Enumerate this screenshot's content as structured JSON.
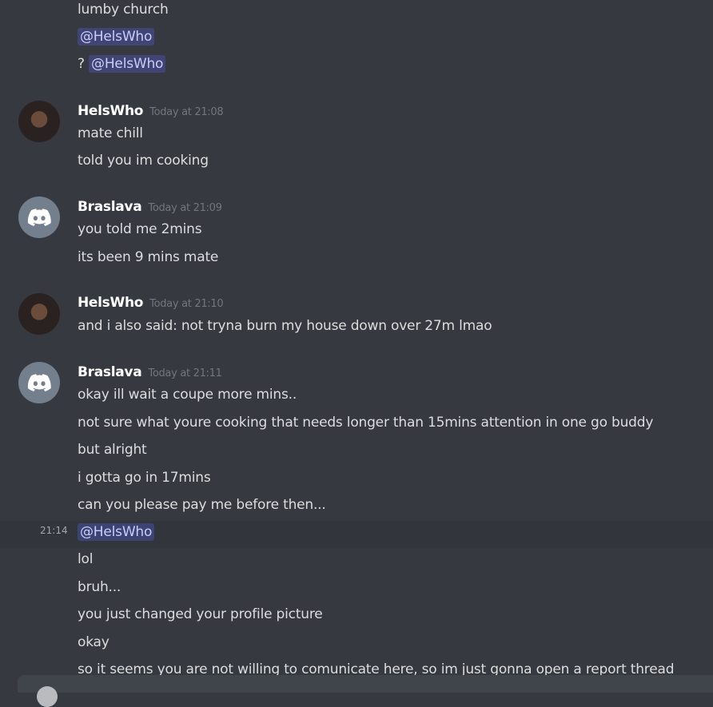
{
  "messages": {
    "top_lines": {
      "l0": "lumby church",
      "l1_mention": "@HelsWho",
      "l2_prefix": "?",
      "l2_mention": "@HelsWho"
    },
    "m1": {
      "author": "HelsWho",
      "time": "Today at 21:08",
      "lines": [
        "mate chill",
        "told you im cooking"
      ]
    },
    "m2": {
      "author": "Braslava",
      "time": "Today at 21:09",
      "lines": [
        "you told me 2mins",
        "its been 9 mins mate"
      ]
    },
    "m3": {
      "author": "HelsWho",
      "time": "Today at 21:10",
      "lines": [
        "and i also said: not tryna burn my house down over 27m lmao"
      ]
    },
    "m4": {
      "author": "Braslava",
      "time": "Today at 21:11",
      "lines": [
        "okay ill wait a coupe more mins..",
        "not sure what youre cooking that needs longer than 15mins attention in one go buddy",
        "but alright",
        "i gotta go in 17mins",
        "can you please pay me before then..."
      ]
    },
    "m5": {
      "side_time": "21:14",
      "mention": "@HelsWho",
      "lines": [
        "lol",
        "bruh...",
        "you just changed your profile picture",
        "okay",
        "so it seems you are not willing to comunicate here, so im just gonna open a report thread"
      ]
    }
  },
  "colors": {
    "background": "#36393f",
    "mention_text": "#c9cdfb",
    "timestamp": "#72767d",
    "discord_avatar_bg": "#747f8d"
  },
  "icons": {
    "discord_avatar": "discord-logo-icon",
    "user_avatar": "profile-photo"
  }
}
